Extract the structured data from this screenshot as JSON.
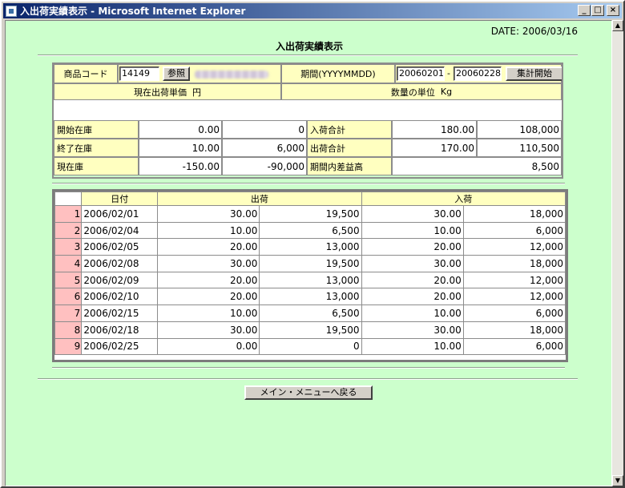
{
  "window": {
    "title": "入出荷実績表示 - Microsoft Internet Explorer"
  },
  "header": {
    "date": "DATE: 2006/03/16",
    "page_title": "入出荷実績表示"
  },
  "search": {
    "product_code_label": "商品コード",
    "product_code_value": "14149",
    "browse_button": "参照",
    "period_label": "期間(YYYYMMDD)",
    "period_from": "20060201",
    "period_separator": "-",
    "period_to": "20060228",
    "start_button": "集計開始",
    "unit_price_label": "現在出荷単価",
    "unit_price_unit": "円",
    "quantity_unit_label": "数量の単位",
    "quantity_unit": "Kg"
  },
  "summary": {
    "opening_stock_label": "開始在庫",
    "opening_stock_qty": "0.00",
    "opening_stock_amount": "0",
    "ending_stock_label": "終了在庫",
    "ending_stock_qty": "10.00",
    "ending_stock_amount": "6,000",
    "current_stock_label": "現在庫",
    "current_stock_qty": "-150.00",
    "current_stock_amount": "-90,000",
    "receipt_total_label": "入荷合計",
    "receipt_total_qty": "180.00",
    "receipt_total_amount": "108,000",
    "shipment_total_label": "出荷合計",
    "shipment_total_qty": "170.00",
    "shipment_total_amount": "110,500",
    "profit_label": "期間内差益高",
    "profit_amount": "8,500"
  },
  "table": {
    "headers": {
      "date": "日付",
      "shipment": "出荷",
      "receipt": "入荷"
    },
    "rows": [
      {
        "idx": "1",
        "date": "2006/02/01",
        "ship_qty": "30.00",
        "ship_amount": "19,500",
        "recv_qty": "30.00",
        "recv_amount": "18,000"
      },
      {
        "idx": "2",
        "date": "2006/02/04",
        "ship_qty": "10.00",
        "ship_amount": "6,500",
        "recv_qty": "10.00",
        "recv_amount": "6,000"
      },
      {
        "idx": "3",
        "date": "2006/02/05",
        "ship_qty": "20.00",
        "ship_amount": "13,000",
        "recv_qty": "20.00",
        "recv_amount": "12,000"
      },
      {
        "idx": "4",
        "date": "2006/02/08",
        "ship_qty": "30.00",
        "ship_amount": "19,500",
        "recv_qty": "30.00",
        "recv_amount": "18,000"
      },
      {
        "idx": "5",
        "date": "2006/02/09",
        "ship_qty": "20.00",
        "ship_amount": "13,000",
        "recv_qty": "20.00",
        "recv_amount": "12,000"
      },
      {
        "idx": "6",
        "date": "2006/02/10",
        "ship_qty": "20.00",
        "ship_amount": "13,000",
        "recv_qty": "20.00",
        "recv_amount": "12,000"
      },
      {
        "idx": "7",
        "date": "2006/02/15",
        "ship_qty": "10.00",
        "ship_amount": "6,500",
        "recv_qty": "10.00",
        "recv_amount": "6,000"
      },
      {
        "idx": "8",
        "date": "2006/02/18",
        "ship_qty": "30.00",
        "ship_amount": "19,500",
        "recv_qty": "30.00",
        "recv_amount": "18,000"
      },
      {
        "idx": "9",
        "date": "2006/02/25",
        "ship_qty": "0.00",
        "ship_amount": "0",
        "recv_qty": "10.00",
        "recv_amount": "6,000"
      }
    ]
  },
  "footer": {
    "main_menu_button": "メイン・メニューへ戻る"
  },
  "colors": {
    "page_bg": "#ccffcc",
    "label_bg": "#ffffc0",
    "index_bg": "#ffc0c0"
  }
}
